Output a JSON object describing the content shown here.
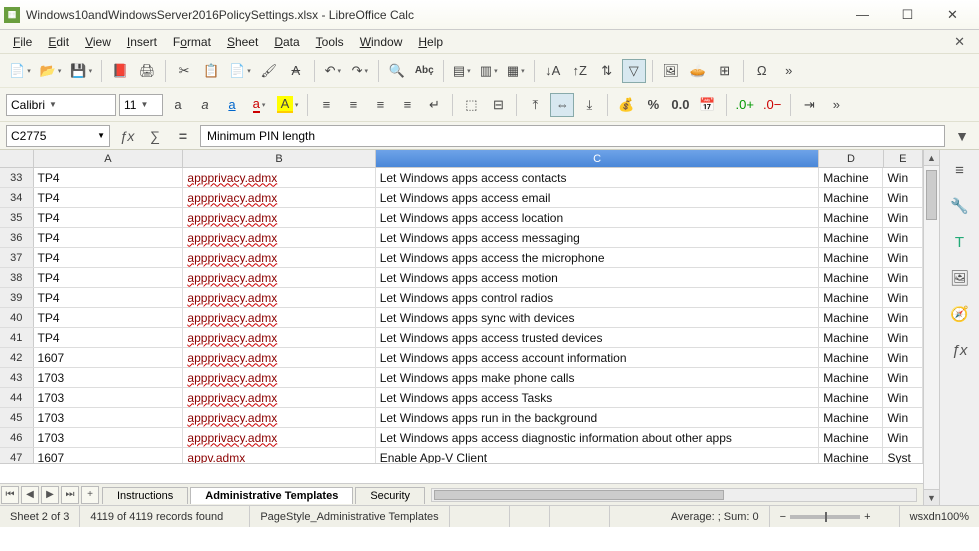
{
  "window": {
    "title": "Windows10andWindowsServer2016PolicySettings.xlsx - LibreOffice Calc",
    "min": "—",
    "max": "☐",
    "close": "✕",
    "menuclose": "✕"
  },
  "menu": {
    "file": "File",
    "edit": "Edit",
    "view": "View",
    "insert": "Insert",
    "format": "Format",
    "sheet": "Sheet",
    "data": "Data",
    "tools": "Tools",
    "window": "Window",
    "help": "Help"
  },
  "format": {
    "font": "Calibri",
    "size": "11"
  },
  "namebox": {
    "ref": "C2775"
  },
  "formula": {
    "value": "Minimum PIN length"
  },
  "columns": {
    "A": "A",
    "B": "B",
    "C": "C",
    "D": "D",
    "E": "E"
  },
  "rows": [
    {
      "n": "33",
      "a": "TP4",
      "b": "appprivacy.admx",
      "c": "Let Windows apps access contacts",
      "d": "Machine",
      "e": "Win"
    },
    {
      "n": "34",
      "a": "TP4",
      "b": "appprivacy.admx",
      "c": "Let Windows apps access email",
      "d": "Machine",
      "e": "Win"
    },
    {
      "n": "35",
      "a": "TP4",
      "b": "appprivacy.admx",
      "c": "Let Windows apps access location",
      "d": "Machine",
      "e": "Win"
    },
    {
      "n": "36",
      "a": "TP4",
      "b": "appprivacy.admx",
      "c": "Let Windows apps access messaging",
      "d": "Machine",
      "e": "Win"
    },
    {
      "n": "37",
      "a": "TP4",
      "b": "appprivacy.admx",
      "c": "Let Windows apps access the microphone",
      "d": "Machine",
      "e": "Win"
    },
    {
      "n": "38",
      "a": "TP4",
      "b": "appprivacy.admx",
      "c": "Let Windows apps access motion",
      "d": "Machine",
      "e": "Win"
    },
    {
      "n": "39",
      "a": "TP4",
      "b": "appprivacy.admx",
      "c": "Let Windows apps control radios",
      "d": "Machine",
      "e": "Win"
    },
    {
      "n": "40",
      "a": "TP4",
      "b": "appprivacy.admx",
      "c": "Let Windows apps sync with devices",
      "d": "Machine",
      "e": "Win"
    },
    {
      "n": "41",
      "a": "TP4",
      "b": "appprivacy.admx",
      "c": "Let Windows apps access trusted devices",
      "d": "Machine",
      "e": "Win"
    },
    {
      "n": "42",
      "a": "1607",
      "b": "appprivacy.admx",
      "c": "Let Windows apps access account information",
      "d": "Machine",
      "e": "Win"
    },
    {
      "n": "43",
      "a": "1703",
      "b": "appprivacy.admx",
      "c": "Let Windows apps make phone calls",
      "d": "Machine",
      "e": "Win"
    },
    {
      "n": "44",
      "a": "1703",
      "b": "appprivacy.admx",
      "c": "Let Windows apps access Tasks",
      "d": "Machine",
      "e": "Win"
    },
    {
      "n": "45",
      "a": "1703",
      "b": "appprivacy.admx",
      "c": "Let Windows apps run in the background",
      "d": "Machine",
      "e": "Win"
    },
    {
      "n": "46",
      "a": "1703",
      "b": "appprivacy.admx",
      "c": "Let Windows apps access diagnostic information about other apps",
      "d": "Machine",
      "e": "Win"
    },
    {
      "n": "47",
      "a": "1607",
      "b": "appv.admx",
      "c": "Enable App-V Client",
      "d": "Machine",
      "e": "Syst"
    }
  ],
  "tabs": {
    "t1": "Instructions",
    "t2": "Administrative Templates",
    "t3": "Security"
  },
  "status": {
    "sheet": "Sheet 2 of 3",
    "records": "4119 of 4119 records found",
    "pagestyle": "PageStyle_Administrative Templates",
    "lang": "",
    "avg": "Average: ; Sum: 0",
    "zoom": "wsxdn100%"
  }
}
